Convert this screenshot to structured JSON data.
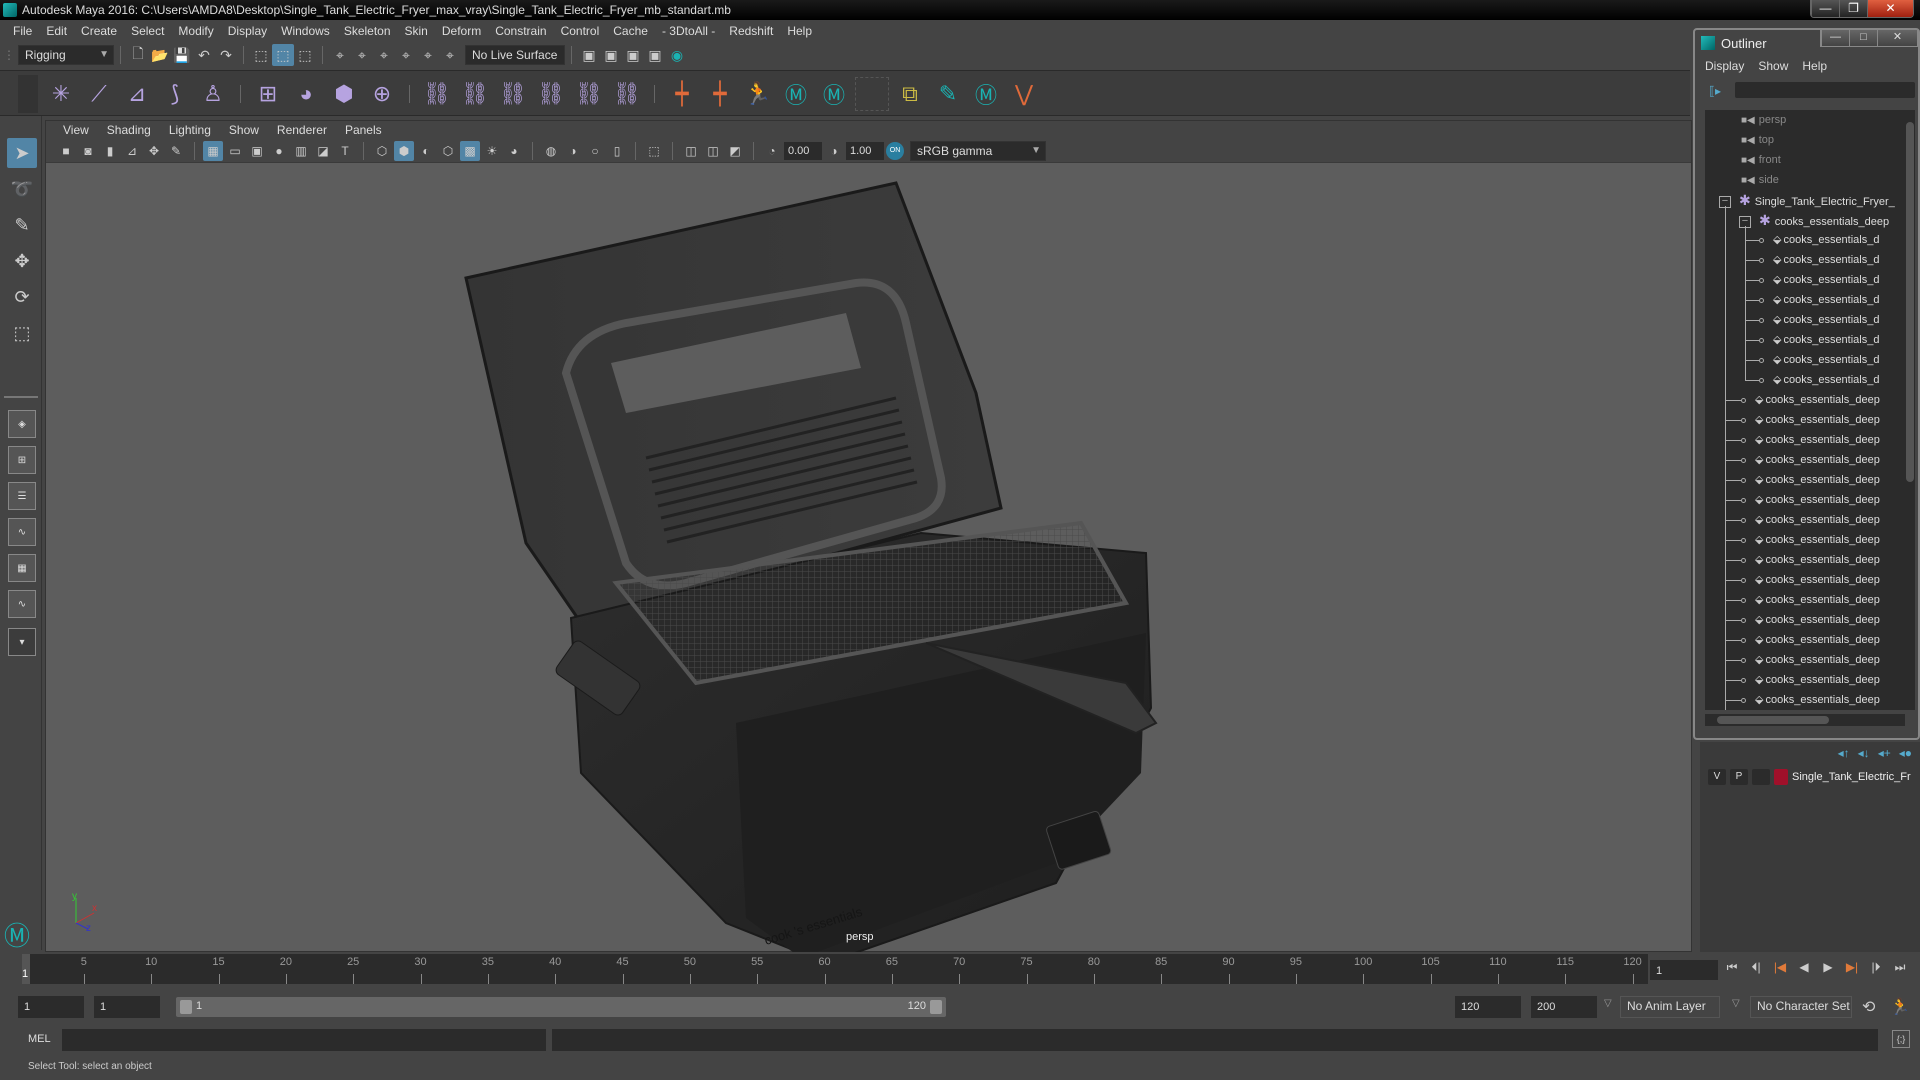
{
  "window": {
    "title": "Autodesk Maya 2016: C:\\Users\\AMDA8\\Desktop\\Single_Tank_Electric_Fryer_max_vray\\Single_Tank_Electric_Fryer_mb_standart.mb",
    "minimize": "—",
    "restore": "❐",
    "close": "✕"
  },
  "menubar": [
    "File",
    "Edit",
    "Create",
    "Select",
    "Modify",
    "Display",
    "Windows",
    "Skeleton",
    "Skin",
    "Deform",
    "Constrain",
    "Control",
    "Cache",
    "- 3DtoAll -",
    "Redshift",
    "Help"
  ],
  "statusline": {
    "menuset": "Rigging",
    "live_surface": "No Live Surface"
  },
  "shelf": {
    "icons": [
      "joint-tool",
      "insert-joint",
      "mirror-joint",
      "ik-handle",
      "quick-rig",
      "bind-skin",
      "smooth-bind",
      "lattice",
      "cluster",
      "parent-constraint",
      "point-constraint",
      "orient-constraint",
      "scale-constraint",
      "aim-constraint",
      "pole-vector-constraint",
      "add-influence",
      "paint-weights",
      "character-controls",
      "maya-logo",
      "maya-logo-2",
      "empty-slot",
      "hold-layers",
      "paint-select",
      "maya-logo-3",
      "vertex-tool"
    ]
  },
  "viewport": {
    "menus": [
      "View",
      "Shading",
      "Lighting",
      "Show",
      "Renderer",
      "Panels"
    ],
    "exposure": "0.00",
    "gamma": "1.00",
    "color_space_toggle": "ON",
    "color_space": "sRGB gamma",
    "camera_label": "persp",
    "axis": {
      "x": "x",
      "y": "y",
      "z": "z"
    },
    "model_brand_text": "cook 's essentials"
  },
  "timeslider": {
    "ticks": [
      5,
      10,
      15,
      20,
      25,
      30,
      35,
      40,
      45,
      50,
      55,
      60,
      65,
      70,
      75,
      80,
      85,
      90,
      95,
      100,
      105,
      110,
      115,
      120
    ],
    "current_frame": "1",
    "current_frame_field": "1",
    "max": 120
  },
  "range": {
    "start": "1",
    "playback_start": "1",
    "slider_start_label": "1",
    "slider_end_label": "120",
    "playback_end": "120",
    "end": "200",
    "anim_layer": "No Anim Layer",
    "character_set": "No Character Set"
  },
  "playback": [
    "go-to-start",
    "step-back-key",
    "step-back-frame",
    "play-backward",
    "play-forward",
    "step-forward-frame",
    "step-forward-key",
    "go-to-end"
  ],
  "mel": {
    "label": "MEL"
  },
  "status": {
    "help_text": "Select Tool: select an object"
  },
  "outliner": {
    "title": "Outliner",
    "menus": [
      "Display",
      "Show",
      "Help"
    ],
    "cameras": [
      "persp",
      "top",
      "front",
      "side"
    ],
    "root": "Single_Tank_Electric_Fryer_",
    "group": "cooks_essentials_deep",
    "children": [
      "cooks_essentials_d",
      "cooks_essentials_d",
      "cooks_essentials_d",
      "cooks_essentials_d",
      "cooks_essentials_d",
      "cooks_essentials_d",
      "cooks_essentials_d",
      "cooks_essentials_d"
    ],
    "siblings": [
      "cooks_essentials_deep",
      "cooks_essentials_deep",
      "cooks_essentials_deep",
      "cooks_essentials_deep",
      "cooks_essentials_deep",
      "cooks_essentials_deep",
      "cooks_essentials_deep",
      "cooks_essentials_deep",
      "cooks_essentials_deep",
      "cooks_essentials_deep",
      "cooks_essentials_deep",
      "cooks_essentials_deep",
      "cooks_essentials_deep",
      "cooks_essentials_deep",
      "cooks_essentials_deep",
      "cooks_essentials_deep"
    ]
  },
  "layers": {
    "v": "V",
    "p": "P",
    "color": "#a0102a",
    "name": "Single_Tank_Electric_Fr"
  },
  "colors": {
    "accent": "#5285a6",
    "viewport_bg": "#5d5d5d",
    "shelf_purple": "#b6a3e0",
    "shelf_orange": "#e06a3a",
    "teal": "#1ab3b3"
  }
}
